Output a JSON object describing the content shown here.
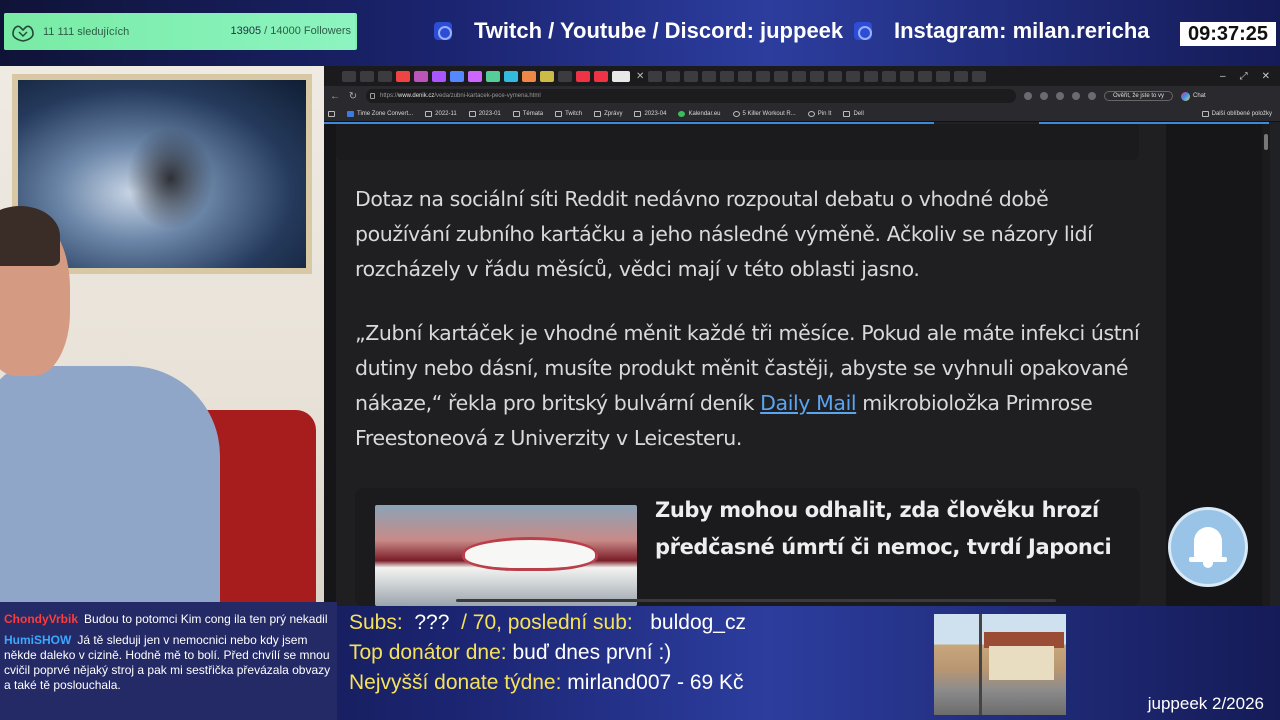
{
  "overlay": {
    "followers": {
      "name": "11 111 sledujících",
      "current": "13905",
      "goal_text": " / 14000 Followers",
      "progress": 0.993
    },
    "socials": [
      {
        "label": "Twitch / Youtube / Discord: juppeek",
        "icon": "twitch-icon"
      },
      {
        "label": "Instagram: milan.rericha",
        "icon": "instagram-icon"
      }
    ],
    "clock": "09:37:25",
    "signature": "juppeek 2/2026"
  },
  "browser": {
    "url_prefix": "https://",
    "url_host": "www.denik.cz",
    "url_path": "/veda/zubni-kartacek-pece-vymena.html",
    "verify_pill": "Ověřit, že jste to vy",
    "chat_label": "Chat",
    "bookmarks": [
      {
        "label": "Time Zone Convert...",
        "icon": "blue"
      },
      {
        "label": "2022-11",
        "icon": "folder"
      },
      {
        "label": "2023-01",
        "icon": "folder"
      },
      {
        "label": "Témata",
        "icon": "folder"
      },
      {
        "label": "Twitch",
        "icon": "folder"
      },
      {
        "label": "Zprávy",
        "icon": "folder"
      },
      {
        "label": "2023-04",
        "icon": "folder"
      },
      {
        "label": "Kalendar.eu",
        "icon": "green"
      },
      {
        "label": "5 Killer Workout R...",
        "icon": "round"
      },
      {
        "label": "Pin It",
        "icon": "round"
      },
      {
        "label": "Dell",
        "icon": "folder"
      }
    ],
    "bookmarks_other": "Další oblíbené položky"
  },
  "article": {
    "para1": "Dotaz na sociální síti Reddit nedávno rozpoutal debatu o vhodné době používání zubního kartáčku a jeho následné výměně. Ačkoliv se názory lidí rozcházely v řádu měsíců, vědci mají v této oblasti jasno.",
    "para2_before": "„Zubní kartáček je vhodné měnit každé tři měsíce. Pokud ale máte infekci ústní dutiny nebo dásní, musíte produkt měnit častěji, abyste se vyhnuli opakované nákaze,“ řekla pro britský bulvární deník ",
    "para2_link": "Daily Mail",
    "para2_after": " mikrobioložka Primrose Freestoneová z Univerzity v Leicesteru.",
    "teaser_title": "Zuby mohou odhalit, zda člověku hrozí předčasné úmrtí či nemoc, tvrdí Japonci"
  },
  "chat": {
    "messages": [
      {
        "user": "ChondyVrbik",
        "color": "#ff3b3b",
        "text": "Budou to potomci Kim cong ila ten prý nekadil"
      },
      {
        "user": "HumiSHOW",
        "color": "#3ba7ff",
        "text": "Já tě sleduji jen v nemocnici nebo kdy jsem někde daleko v cizině. Hodně mě to bolí. Před chvílí se mnou cvičil poprvé nějaký stroj a pak mi sestřička převázala obvazy a také tě poslouchala."
      }
    ]
  },
  "stats": {
    "subs_label": "Subs:",
    "subs_value": "???",
    "subs_goal": "/ 70, poslední sub:",
    "last_sub": "buldog_cz",
    "top_donator_label": "Top donátor dne:",
    "top_donator_value": "buď dnes první :)",
    "top_donate_week_label": "Nejvyšší donate týdne:",
    "top_donate_week_value": "mirland007 - 69 Kč"
  }
}
